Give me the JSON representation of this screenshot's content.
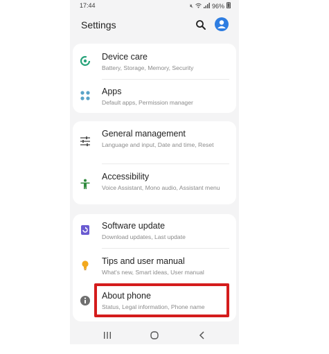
{
  "status": {
    "time": "17:44",
    "battery": "96%",
    "icons": [
      "mute-icon",
      "wifi-icon",
      "signal-icon",
      "battery-icon"
    ]
  },
  "header": {
    "title": "Settings",
    "icons": [
      "search-icon",
      "account-icon"
    ]
  },
  "groups": [
    {
      "items": [
        {
          "icon": "device-care-icon",
          "title": "Device care",
          "subtitle": "Battery, Storage, Memory, Security"
        },
        {
          "icon": "apps-icon",
          "title": "Apps",
          "subtitle": "Default apps, Permission manager"
        }
      ]
    },
    {
      "items": [
        {
          "icon": "general-management-icon",
          "title": "General management",
          "subtitle": "Language and input, Date and time, Reset"
        },
        {
          "icon": "accessibility-icon",
          "title": "Accessibility",
          "subtitle": "Voice Assistant, Mono audio, Assistant menu"
        }
      ]
    },
    {
      "items": [
        {
          "icon": "software-update-icon",
          "title": "Software update",
          "subtitle": "Download updates, Last update"
        },
        {
          "icon": "tips-icon",
          "title": "Tips and user manual",
          "subtitle": "What's new, Smart ideas, User manual"
        },
        {
          "icon": "info-icon",
          "title": "About phone",
          "subtitle": "Status, Legal information, Phone name"
        }
      ]
    }
  ],
  "navbar": {
    "icons": [
      "recents-icon",
      "home-icon",
      "back-icon"
    ]
  },
  "colors": {
    "accent": "#2e7de1",
    "highlight": "#d41c1c",
    "device_care": "#27a37a",
    "apps": "#5aa3c8",
    "accessibility": "#2f8a3d",
    "software_update": "#6a5bd1",
    "tips": "#f2a81d",
    "info": "#6f6f6f"
  }
}
